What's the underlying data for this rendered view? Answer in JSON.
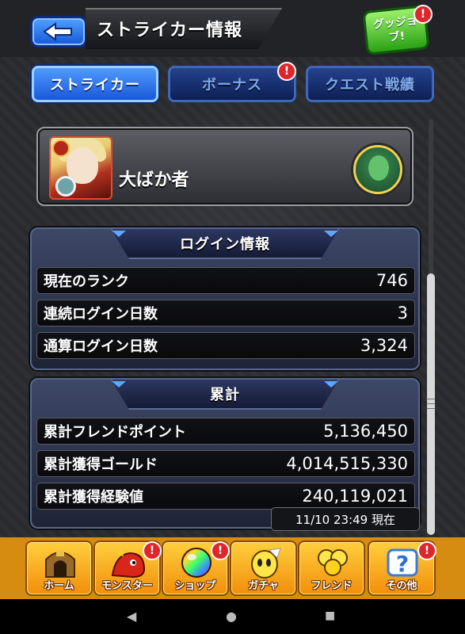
{
  "header": {
    "title": "ストライカー情報",
    "good_job_label": "グッジョブ!",
    "badge": "!"
  },
  "tabs": [
    {
      "label": "ストライカー",
      "active": true
    },
    {
      "label": "ボーナス",
      "active": false,
      "badge": "!"
    },
    {
      "label": "クエスト戦績",
      "active": false
    }
  ],
  "profile": {
    "name": "大ばか者"
  },
  "login_section": {
    "title": "ログイン情報",
    "rows": [
      {
        "label": "現在のランク",
        "value": "746"
      },
      {
        "label": "連続ログイン日数",
        "value": "3"
      },
      {
        "label": "通算ログイン日数",
        "value": "3,324"
      }
    ]
  },
  "total_section": {
    "title": "累計",
    "rows": [
      {
        "label": "累計フレンドポイント",
        "value": "5,136,450"
      },
      {
        "label": "累計獲得ゴールド",
        "value": "4,014,515,330"
      },
      {
        "label": "累計獲得経験値",
        "value": "240,119,021"
      }
    ],
    "timestamp": "11/10 23:49 現在"
  },
  "bottom_nav": [
    {
      "label": "ホーム",
      "icon": "home-icon",
      "badge": ""
    },
    {
      "label": "モンスター",
      "icon": "monster-icon",
      "badge": "!"
    },
    {
      "label": "ショップ",
      "icon": "shop-orb-icon",
      "badge": "!"
    },
    {
      "label": "ガチャ",
      "icon": "gacha-egg-icon",
      "badge": ""
    },
    {
      "label": "フレンド",
      "icon": "friend-balloon-icon",
      "badge": ""
    },
    {
      "label": "その他",
      "icon": "other-question-icon",
      "badge": "!"
    }
  ],
  "system_nav": {
    "back": "◀",
    "home": "●",
    "recents": "■"
  },
  "colors": {
    "accent_blue": "#1a58d8",
    "nav_orange": "#f18e0c",
    "badge_red": "#e0262b"
  }
}
